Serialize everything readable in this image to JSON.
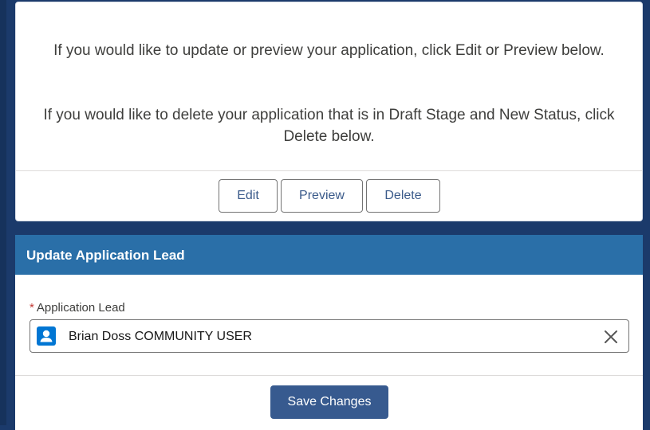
{
  "messages": {
    "update_preview": "If you would like to update or preview your application, click Edit or Preview below.",
    "delete": "If you would like to delete your application that is in Draft Stage and New Status, click Delete below."
  },
  "actions": {
    "edit_label": "Edit",
    "preview_label": "Preview",
    "delete_label": "Delete"
  },
  "lead_section": {
    "title": "Update Application Lead",
    "required_marker": "*",
    "field_label": "Application Lead",
    "field_value": "Brian Doss COMMUNITY USER",
    "field_icon": "user-icon",
    "clear_icon": "close-icon",
    "save_label": "Save Changes"
  },
  "colors": {
    "header_bg": "#2a6fa8",
    "primary_button": "#375a8f",
    "user_icon": "#0176d3",
    "required": "#c23934"
  }
}
